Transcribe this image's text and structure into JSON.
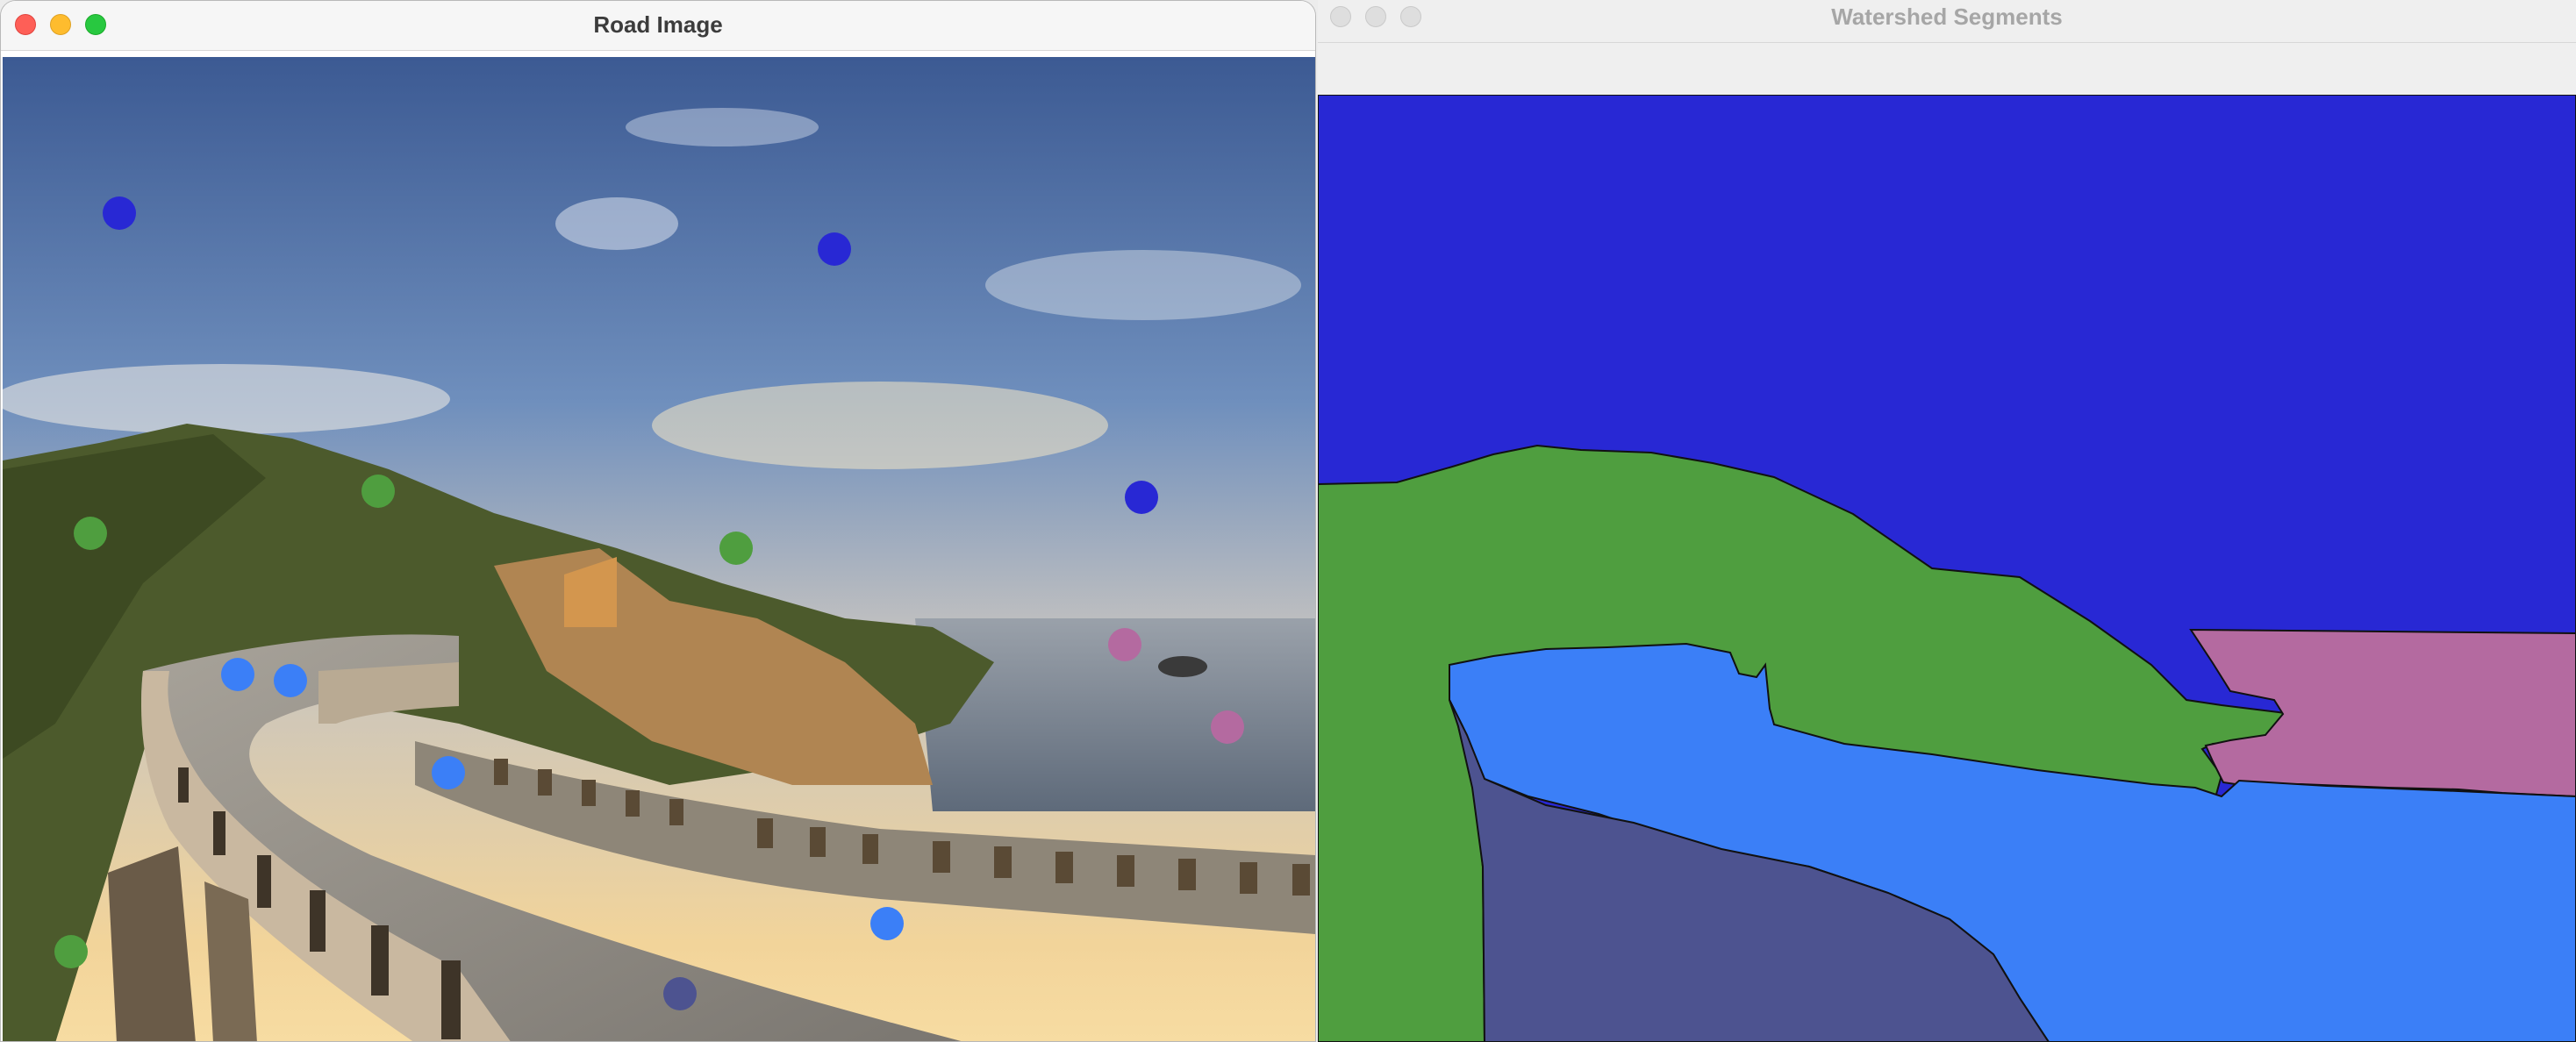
{
  "windows": {
    "road": {
      "title": "Road Image",
      "traffic_lights": {
        "close": "#fe5f57",
        "minimize": "#febc2e",
        "zoom": "#28c840"
      }
    },
    "segments": {
      "title": "Watershed Segments",
      "traffic_lights_state": "inactive"
    }
  },
  "colors": {
    "sky": "#2828d4",
    "hills": "#4f9e3f",
    "road": "#3b7ff7",
    "ocean": "#b46aa0",
    "bridge": "#4d5390"
  },
  "markers": [
    {
      "segment": "sky",
      "color": "#2828d4"
    },
    {
      "segment": "sky",
      "color": "#2828d4"
    },
    {
      "segment": "sky",
      "color": "#2828d4"
    },
    {
      "segment": "hills",
      "color": "#4f9e3f"
    },
    {
      "segment": "hills",
      "color": "#4f9e3f"
    },
    {
      "segment": "hills",
      "color": "#4f9e3f"
    },
    {
      "segment": "hills",
      "color": "#4f9e3f"
    },
    {
      "segment": "ocean",
      "color": "#b46aa0"
    },
    {
      "segment": "ocean",
      "color": "#b46aa0"
    },
    {
      "segment": "road",
      "color": "#3b7ff7"
    },
    {
      "segment": "road",
      "color": "#3b7ff7"
    },
    {
      "segment": "road",
      "color": "#3b7ff7"
    },
    {
      "segment": "road",
      "color": "#3b7ff7"
    },
    {
      "segment": "bridge",
      "color": "#4d5390"
    }
  ]
}
